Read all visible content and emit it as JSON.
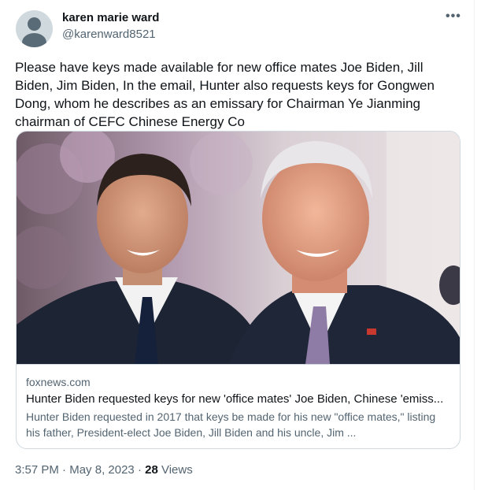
{
  "author": {
    "display_name": "karen marie ward",
    "handle": "@karenward8521"
  },
  "menu_icon": "more-horizontal-icon",
  "tweet": {
    "text": "Please have keys made available for new office mates Joe Biden, Jill Biden, Jim Biden, In the email, Hunter also requests keys for Gongwen Dong, whom he describes as an emissary for Chairman Ye Jianming chairman of CEFC Chinese Energy Co"
  },
  "link_card": {
    "domain": "foxnews.com",
    "title": "Hunter Biden requested keys for new 'office mates' Joe Biden, Chinese 'emiss...",
    "description": "Hunter Biden requested in 2017 that keys be made for his new \"office mates,\" listing his father, President-elect Joe Biden, Jill Biden and his uncle, Jim ..."
  },
  "meta": {
    "time": "3:57 PM",
    "separator": " · ",
    "date": "May 8, 2023",
    "views_count": "28",
    "views_label": " Views"
  },
  "colors": {
    "text_primary": "#0f1419",
    "text_secondary": "#536471",
    "border": "#cfd9de",
    "avatar_bg": "#cfd9de",
    "avatar_fg": "#5a6b78"
  }
}
